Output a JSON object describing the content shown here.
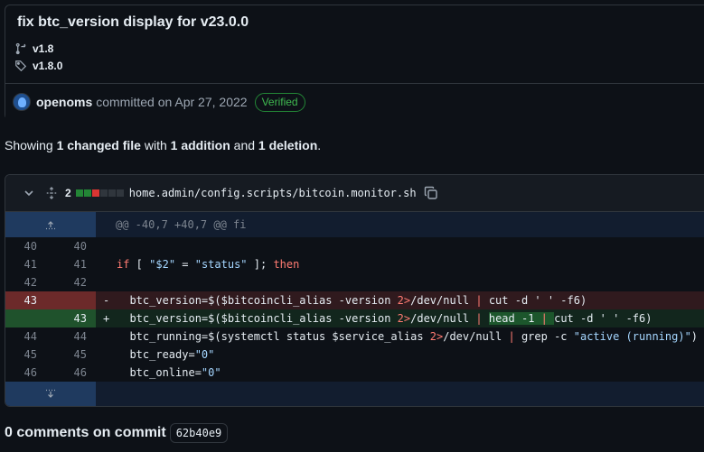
{
  "commit": {
    "title": "fix btc_version display for v23.0.0",
    "branch": "v1.8",
    "tag": "v1.8.0",
    "author": "openoms",
    "committed_text": "committed on Apr 27, 2022",
    "verified_label": "Verified"
  },
  "summary": {
    "prefix": "Showing",
    "files": "1 changed file",
    "with": "with",
    "additions": "1 addition",
    "and": "and",
    "deletions": "1 deletion",
    "suffix": "."
  },
  "diff": {
    "changes_count": "2",
    "diffstat": [
      "add",
      "add",
      "del",
      "neutral",
      "neutral",
      "neutral"
    ],
    "colors": {
      "add": "#238636",
      "del": "#da3633",
      "neutral": "#30363d"
    },
    "file_path": "home.admin/config.scripts/bitcoin.monitor.sh",
    "hunk_header": "@@ -40,7 +40,7 @@ fi",
    "lines": [
      {
        "old": "40",
        "new": "40",
        "marker": "",
        "type": "ctx",
        "code": ""
      },
      {
        "old": "41",
        "new": "41",
        "marker": "",
        "type": "ctx",
        "code": "if [ \"$2\" = \"status\" ]; then"
      },
      {
        "old": "42",
        "new": "42",
        "marker": "",
        "type": "ctx",
        "code": ""
      },
      {
        "old": "43",
        "new": "",
        "marker": "-",
        "type": "del",
        "code": "  btc_version=$($bitcoincli_alias -version 2>/dev/null | cut -d ' ' -f6)"
      },
      {
        "old": "",
        "new": "43",
        "marker": "+",
        "type": "add",
        "code": "  btc_version=$($bitcoincli_alias -version 2>/dev/null | head -1 | cut -d ' ' -f6)"
      },
      {
        "old": "44",
        "new": "44",
        "marker": "",
        "type": "ctx",
        "code": "  btc_running=$(systemctl status $service_alias 2>/dev/null | grep -c \"active (running)\")"
      },
      {
        "old": "45",
        "new": "45",
        "marker": "",
        "type": "ctx",
        "code": "  btc_ready=\"0\""
      },
      {
        "old": "46",
        "new": "46",
        "marker": "",
        "type": "ctx",
        "code": "  btc_online=\"0\""
      }
    ]
  },
  "comments": {
    "title": "0 comments on commit",
    "sha": "62b40e9"
  },
  "icons": [
    "git-branch-icon",
    "tag-icon",
    "chevron-down-icon",
    "fold-icon",
    "copy-icon",
    "expand-up-icon",
    "expand-down-icon"
  ]
}
